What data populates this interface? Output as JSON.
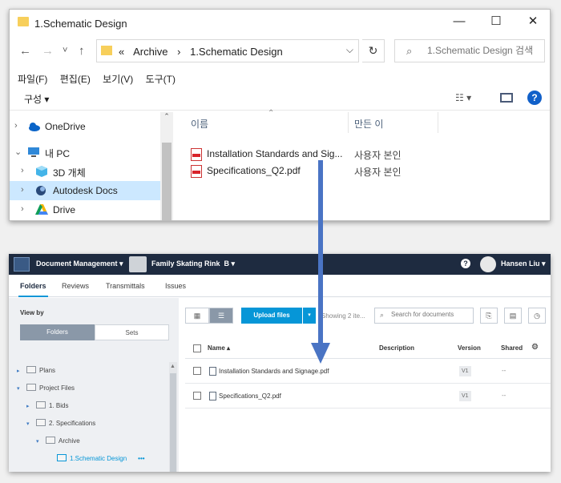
{
  "explorer": {
    "title": "1.Schematic Design",
    "window_controls": {
      "minimize": "—",
      "maximize": "☐",
      "close": "✕"
    },
    "nav": {
      "back": "←",
      "forward": "→",
      "recent": "˅",
      "up": "↑"
    },
    "address": {
      "overflow": "«",
      "crumbs": [
        "Archive",
        "›",
        "1.Schematic Design"
      ],
      "dropdown": "⌵"
    },
    "search_placeholder": "1.Schematic Design 검색",
    "menu": [
      "파일(F)",
      "편집(E)",
      "보기(V)",
      "도구(T)"
    ],
    "organize": "구성 ▾",
    "view_toggle": "☷ ▾",
    "help": "?",
    "nav_pane": [
      {
        "label": "OneDrive",
        "chevron": "›",
        "icon": "onedrive-icon",
        "selected": false
      },
      {
        "label": "내 PC",
        "chevron": "⌄",
        "icon": "pc-icon",
        "selected": false
      },
      {
        "label": "3D 개체",
        "chevron": "›",
        "icon": "3d-objects-icon",
        "selected": false
      },
      {
        "label": "Autodesk Docs",
        "chevron": "›",
        "icon": "autodesk-docs-icon",
        "selected": true
      },
      {
        "label": "Drive",
        "chevron": "›",
        "icon": "drive-icon",
        "selected": false
      }
    ],
    "columns": {
      "name": "이름",
      "owner": "만든 이"
    },
    "files": [
      {
        "name": "Installation Standards and Sig...",
        "owner": "사용자 본인"
      },
      {
        "name": "Specifications_Q2.pdf",
        "owner": "사용자 본인"
      }
    ]
  },
  "docs": {
    "module": "Document Management ▾",
    "project": "Family Skating Rink",
    "project_badge": "B ▾",
    "help": "?",
    "user": "Hansen Liu ▾",
    "tabs": [
      "Folders",
      "Reviews",
      "Transmittals",
      "Issues"
    ],
    "view_by": "View by",
    "segments": [
      "Folders",
      "Sets"
    ],
    "tree": [
      {
        "label": "Plans",
        "chevron": "▸",
        "indent": 0,
        "selected": false
      },
      {
        "label": "Project Files",
        "chevron": "▾",
        "indent": 0,
        "selected": false
      },
      {
        "label": "1. Bids",
        "chevron": "▸",
        "indent": 1,
        "selected": false
      },
      {
        "label": "2. Specifications",
        "chevron": "▾",
        "indent": 1,
        "selected": false
      },
      {
        "label": "Archive",
        "chevron": "▾",
        "indent": 2,
        "selected": false
      },
      {
        "label": "1.Schematic Design",
        "chevron": "",
        "indent": 3,
        "selected": true
      }
    ],
    "more": "•••",
    "upload_label": "Upload files",
    "upload_dd": "▾",
    "showing": "Showing 2 ite...",
    "search_placeholder": "Search for documents",
    "columns": {
      "name": "Name ▴",
      "description": "Description",
      "version": "Version",
      "shared": "Shared"
    },
    "files": [
      {
        "name": "Installation Standards and Signage.pdf",
        "version": "V1",
        "shared": "--"
      },
      {
        "name": "Specifications_Q2.pdf",
        "version": "V1",
        "shared": "--"
      }
    ]
  },
  "colors": {
    "accent": "#0696d7",
    "header": "#1e2b40",
    "selection": "#cce8ff",
    "arrow": "#4a74c4"
  }
}
